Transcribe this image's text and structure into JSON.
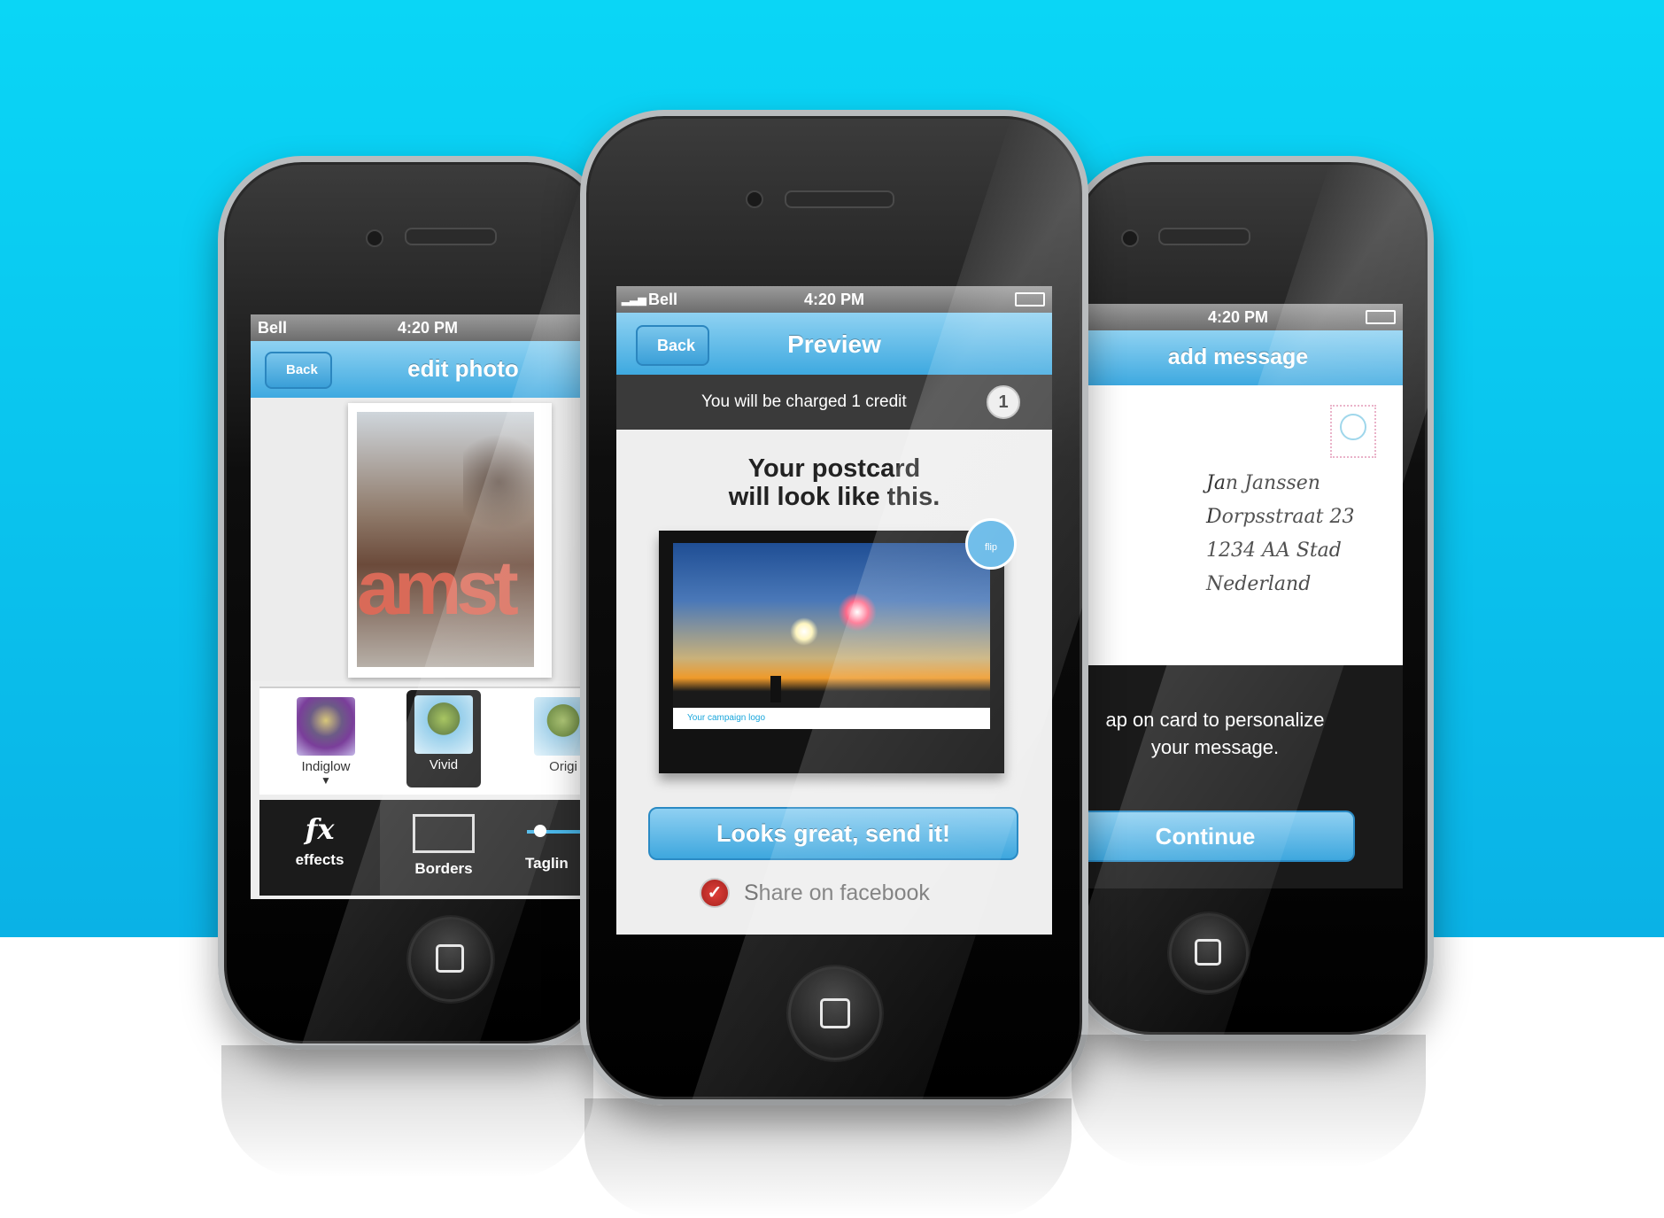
{
  "status_bar": {
    "carrier": "Bell",
    "time": "4:20 PM"
  },
  "left_phone": {
    "back_label": "Back",
    "title": "edit photo",
    "photo_text": "amst",
    "filters": [
      "Indiglow",
      "Vivid",
      "Origi"
    ],
    "tools": {
      "effects_icon": "fx",
      "effects": "effects",
      "borders": "Borders",
      "tagline": "Taglin"
    }
  },
  "center_phone": {
    "back_label": "Back",
    "title": "Preview",
    "charge_text": "You will be charged 1 credit",
    "credit_count": "1",
    "heading_line1": "Your postcard",
    "heading_line2": "will look like this.",
    "flip_label": "flip",
    "campaign_logo": "Your campaign logo",
    "send_button": "Looks great, send it!",
    "share_label": "Share on facebook",
    "share_checked": true
  },
  "right_phone": {
    "title": "add message",
    "address_lines": [
      "Jan Janssen",
      "Dorpsstraat 23",
      "1234 AA Stad",
      "Nederland"
    ],
    "hint_line1": "ap on card to personalize",
    "hint_line2": "your message.",
    "continue_button": "Continue"
  },
  "colors": {
    "background_top": "#0ad6f6",
    "accent_blue": "#3ea9e0",
    "check_red": "#c8302b"
  },
  "icons": [
    "signal-icon",
    "battery-icon",
    "back-chevron-icon",
    "fx-icon",
    "border-icon",
    "slider-icon",
    "flip-icon",
    "checkmark-icon",
    "home-button-icon"
  ]
}
